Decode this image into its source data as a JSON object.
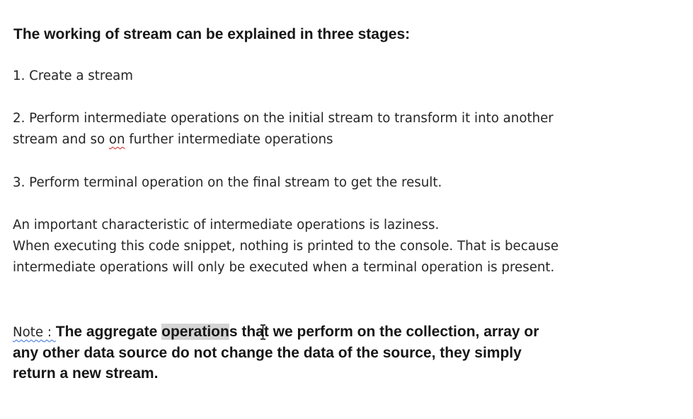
{
  "document": {
    "heading": "The working of stream can be explained in three stages:",
    "step1": "1. Create a stream",
    "step2": {
      "line1": "2. Perform intermediate operations on the initial stream to transform it into another",
      "line2_before": "stream and so ",
      "line2_flagged": "on",
      "line2_after": " further intermediate operations"
    },
    "step3": "3. Perform terminal operation on the final stream to get the result.",
    "laziness": {
      "line1": "An important characteristic of intermediate operations is laziness.",
      "line2": "When executing this code snippet, nothing is printed to the console. That is because",
      "line3": "intermediate operations will only be executed when a terminal operation is present."
    },
    "note": {
      "label_word": "Note",
      "label_sep": " : ",
      "lead": "The aggregate ",
      "selected": "operation",
      "rest_line1": "s that we perform on the collection, array or",
      "line2": "any other data source do not change the data of the source, they simply",
      "line3": "return a new stream."
    }
  },
  "colors": {
    "text": "#262626",
    "spell_squiggle": "#d02020",
    "grammar_squiggle": "#3a6fd8",
    "selection": "#d4d4d4"
  },
  "icons": {
    "cursor": "text-ibeam-cursor-icon"
  }
}
